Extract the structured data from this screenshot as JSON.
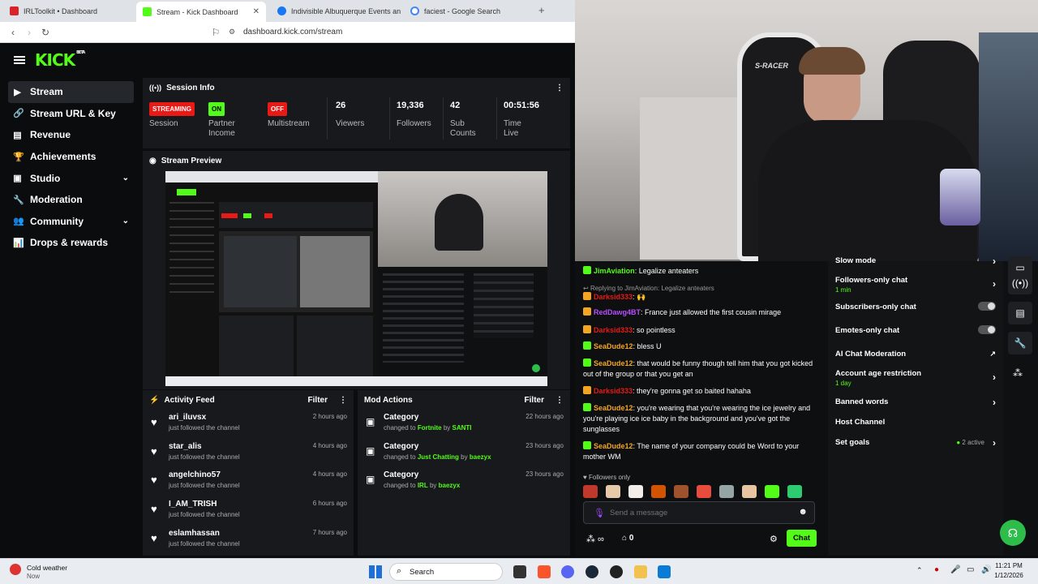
{
  "browser": {
    "tabs": [
      {
        "title": "IRLToolkit • Dashboard",
        "color": "#d9222a",
        "active": false
      },
      {
        "title": "Stream - Kick Dashboard",
        "color": "#53fc18",
        "active": true
      },
      {
        "title": "Indivisible Albuquerque Events and A",
        "color": "#1877f2",
        "active": false
      },
      {
        "title": "faciest - Google Search",
        "color": "#4285f4",
        "active": false
      }
    ],
    "new_tab": "+",
    "url": "dashboard.kick.com/stream"
  },
  "kick": {
    "logo": "KICK",
    "beta": "BETA",
    "sidebar": [
      {
        "label": "Stream",
        "icon": "▶",
        "active": true,
        "chevron": false
      },
      {
        "label": "Stream URL & Key",
        "icon": "🔗",
        "active": false,
        "chevron": false
      },
      {
        "label": "Revenue",
        "icon": "▤",
        "active": false,
        "chevron": false
      },
      {
        "label": "Achievements",
        "icon": "🏆",
        "active": false,
        "chevron": false
      },
      {
        "label": "Studio",
        "icon": "▣",
        "active": false,
        "chevron": true
      },
      {
        "label": "Moderation",
        "icon": "🔧",
        "active": false,
        "chevron": false
      },
      {
        "label": "Community",
        "icon": "👥",
        "active": false,
        "chevron": true
      },
      {
        "label": "Drops & rewards",
        "icon": "📊",
        "active": false,
        "chevron": false
      }
    ],
    "session": {
      "title": "Session Info",
      "stats": [
        {
          "badge": "STREAMING",
          "badge_color": "#e91916",
          "label": "Session"
        },
        {
          "badge": "ON",
          "badge_color": "#53fc18",
          "label": "Partner Income"
        },
        {
          "badge": "OFF",
          "badge_color": "#e91916",
          "label": "Multistream"
        },
        {
          "value": "26",
          "label": "Viewers"
        },
        {
          "value": "19,336",
          "label": "Followers"
        },
        {
          "value": "42",
          "label": "Sub Counts"
        },
        {
          "value": "00:51:56",
          "label": "Time Live"
        }
      ]
    },
    "preview": {
      "title": "Stream Preview"
    },
    "activity": {
      "title": "Activity Feed",
      "filter": "Filter",
      "items": [
        {
          "name": "ari_iluvsx",
          "sub": "just followed the channel",
          "time": "2 hours ago"
        },
        {
          "name": "star_alis",
          "sub": "just followed the channel",
          "time": "4 hours ago"
        },
        {
          "name": "angelchino57",
          "sub": "just followed the channel",
          "time": "4 hours ago"
        },
        {
          "name": "I_AM_TRISH",
          "sub": "just followed the channel",
          "time": "6 hours ago"
        },
        {
          "name": "eslamhassan",
          "sub": "just followed the channel",
          "time": "7 hours ago"
        }
      ]
    },
    "mod": {
      "title": "Mod Actions",
      "filter": "Filter",
      "items": [
        {
          "name": "Category",
          "prefix": "changed to",
          "target": "Fortnite",
          "by": "by",
          "user": "SANTI",
          "time": "22 hours ago"
        },
        {
          "name": "Category",
          "prefix": "changed to",
          "target": "Just Chatting",
          "by": "by",
          "user": "baezyx",
          "time": "23 hours ago"
        },
        {
          "name": "Category",
          "prefix": "changed to",
          "target": "IRL",
          "by": "by",
          "user": "baezyx",
          "time": "23 hours ago"
        }
      ]
    }
  },
  "chat": {
    "messages": [
      {
        "user": "JimAviation",
        "color": "#53fc18",
        "text": ": Legalize anteaters"
      },
      {
        "reply": "Replying to JimAviation: Legalize anteaters"
      },
      {
        "user": "Darksid333",
        "color": "#e91916",
        "text": ": 🙌"
      },
      {
        "user": "RedDawg4BT",
        "color": "#b84dff",
        "text": ": France just allowed the first cousin mirage"
      },
      {
        "user": "Darksid333",
        "color": "#e91916",
        "text": ": so pointless"
      },
      {
        "user": "SeaDude12",
        "color": "#f4a623",
        "text": ": bless U"
      },
      {
        "user": "SeaDude12",
        "color": "#f4a623",
        "text": ": that would be funny though tell him that you got kicked out of the group or that you get an"
      },
      {
        "user": "Darksid333",
        "color": "#e91916",
        "text": ": they're gonna get so baited hahaha"
      },
      {
        "user": "SeaDude12",
        "color": "#f4a623",
        "text": ": you're wearing that you're wearing the ice jewelry and you're playing ice ice baby in the background and you've got the sunglasses"
      },
      {
        "user": "SeaDude12",
        "color": "#f4a623",
        "text": ": The name of your company could be Word to your mother WM"
      }
    ],
    "followers_only": "Followers only",
    "placeholder": "Send a message",
    "count": "0",
    "chat_button": "Chat"
  },
  "settings": {
    "items": [
      {
        "label": "Slow mode",
        "kind": "chevron"
      },
      {
        "label": "Followers-only chat",
        "sub": "1 min",
        "kind": "chevron"
      },
      {
        "label": "Subscribers-only chat",
        "kind": "toggle"
      },
      {
        "label": "Emotes-only chat",
        "kind": "toggle"
      },
      {
        "label": "AI Chat Moderation",
        "kind": "external"
      },
      {
        "label": "Account age restriction",
        "sub": "1 day",
        "kind": "chevron"
      },
      {
        "label": "Banned words",
        "kind": "chevron"
      },
      {
        "label": "Host Channel",
        "kind": "none"
      },
      {
        "label": "Set goals",
        "extra": "2 active",
        "kind": "chevron"
      }
    ]
  },
  "taskbar": {
    "weather_title": "Cold weather",
    "weather_sub": "Now",
    "search": "Search",
    "time": "11:21 PM",
    "date": "1/12/2026"
  },
  "colors": {
    "accent": "#53fc18",
    "live": "#e91916"
  }
}
